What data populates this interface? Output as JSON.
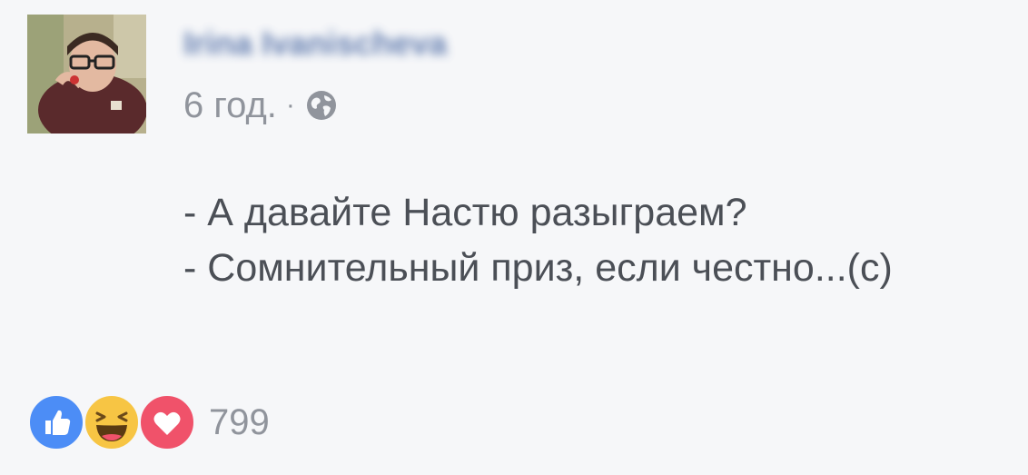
{
  "post": {
    "author": "Irina Ivanischeva",
    "timestamp": "6 год.",
    "separator": "·",
    "privacy_icon": "globe-icon",
    "text_lines": [
      "- А давайте Настю разыграем?",
      "- Сомнительный приз, если честно...(c)"
    ]
  },
  "reactions": {
    "icons": [
      "like-icon",
      "haha-icon",
      "love-icon"
    ],
    "count": "799"
  },
  "colors": {
    "like": "#4c8df6",
    "haha": "#f7c544",
    "love": "#f0526a",
    "meta_text": "#90949c",
    "body_text": "#4b4f56",
    "background": "#f6f7f9"
  }
}
